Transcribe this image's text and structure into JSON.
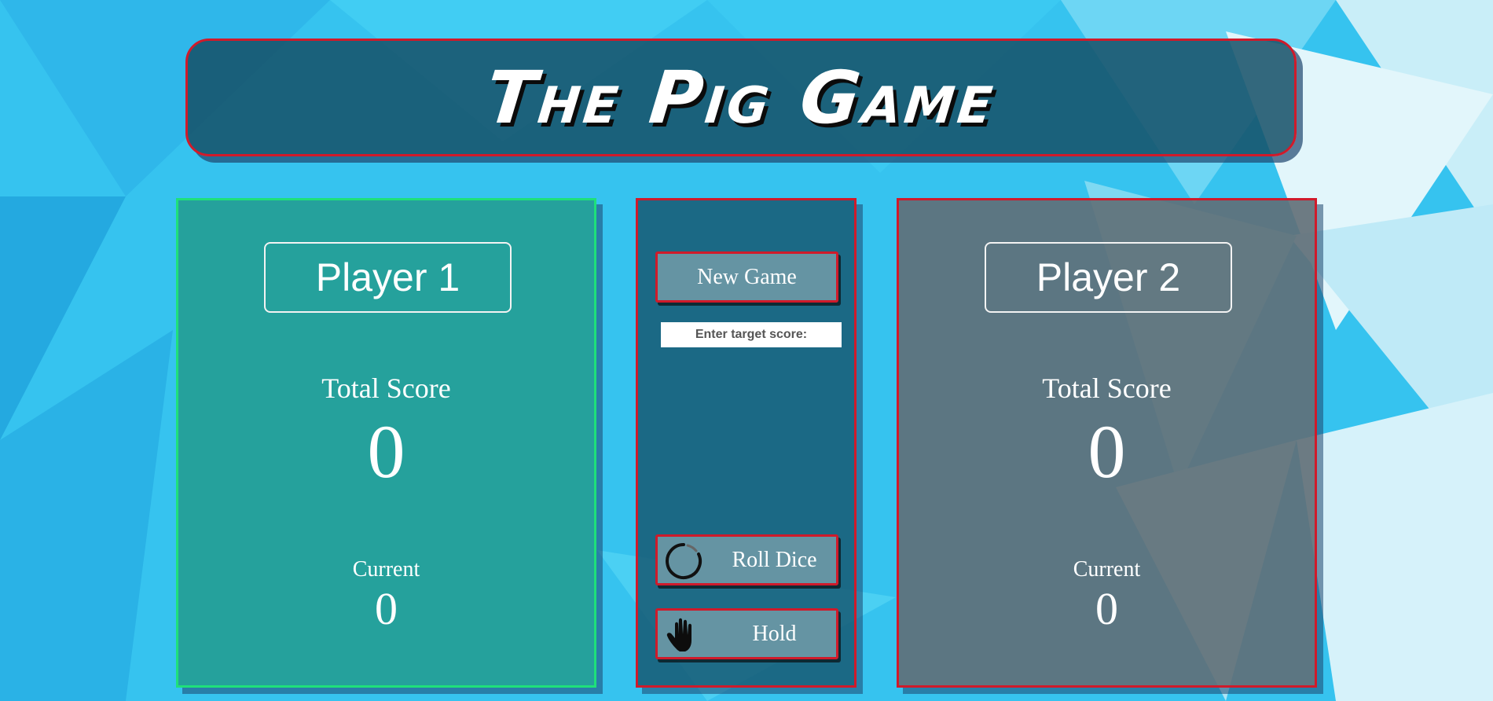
{
  "title": "The Pig Game",
  "players": [
    {
      "name": "Player 1",
      "total_label": "Total Score",
      "total_score": "0",
      "current_label": "Current",
      "current_score": "0",
      "active": true,
      "border_color": "#1fe07a"
    },
    {
      "name": "Player 2",
      "total_label": "Total Score",
      "total_score": "0",
      "current_label": "Current",
      "current_score": "0",
      "active": false,
      "border_color": "#d01a2a"
    }
  ],
  "controls": {
    "new_game_label": "New Game",
    "target_placeholder": "Enter target score:",
    "roll_label": "Roll Dice",
    "roll_icon": "spinner-icon",
    "hold_label": "Hold",
    "hold_icon": "hand-icon"
  },
  "colors": {
    "accent_red": "#d01a2a",
    "active_green": "#1fe07a",
    "background_blue": "#3cc8f0"
  }
}
